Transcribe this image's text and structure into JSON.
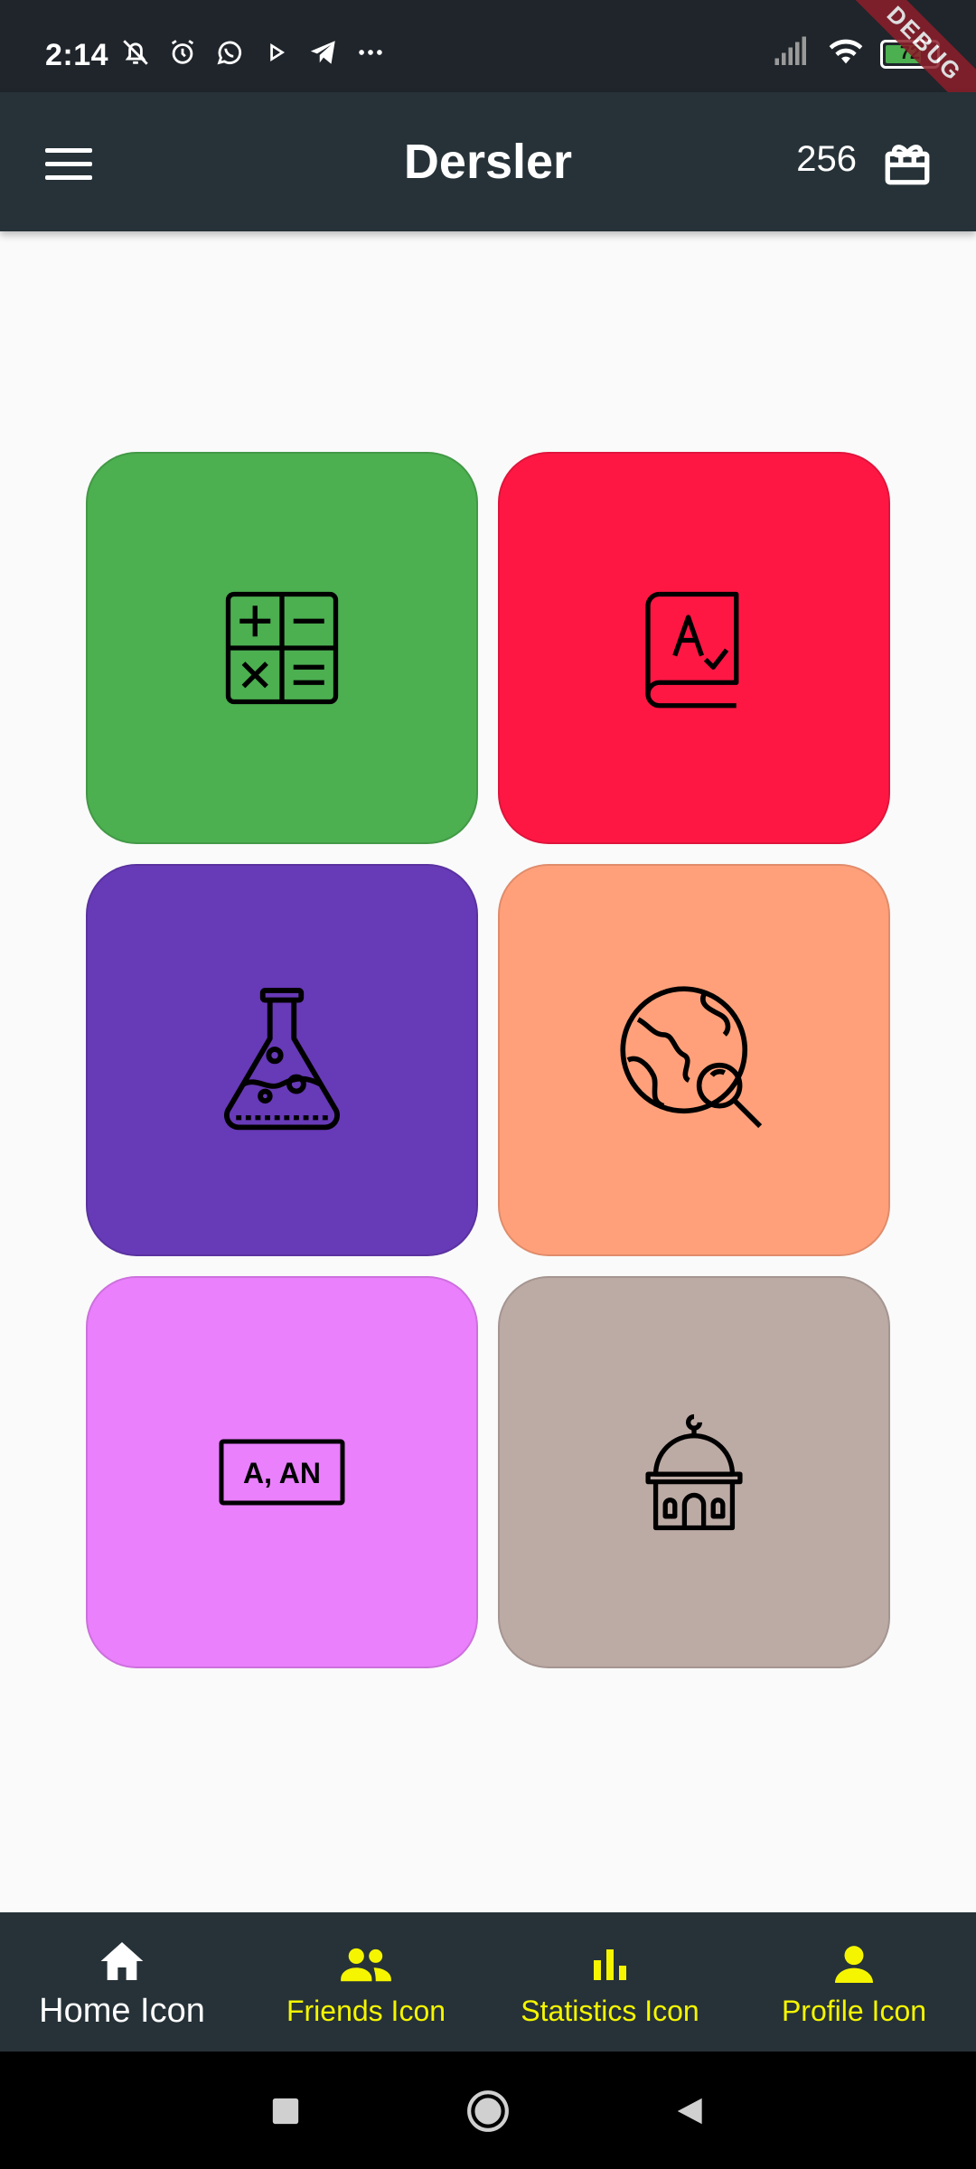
{
  "status_bar": {
    "time": "2:14",
    "battery": "72",
    "battery_level": 0.72,
    "debug_banner": "DEBUG",
    "icons": [
      "bell-off-icon",
      "alarm-icon",
      "whatsapp-icon",
      "play-icon",
      "telegram-icon",
      "more-icon",
      "signal-icon",
      "wifi-icon",
      "battery-icon"
    ]
  },
  "app_bar": {
    "title": "Dersler",
    "coins": "256",
    "menu_icon": "menu-icon",
    "gift_icon": "gift-icon"
  },
  "subjects": [
    {
      "name": "math-tile",
      "icon": "calculator-icon",
      "color": "#4caf50"
    },
    {
      "name": "turkish-tile",
      "icon": "dictionary-book-icon",
      "color": "#ff1744"
    },
    {
      "name": "science-tile",
      "icon": "flask-icon",
      "color": "#673ab7"
    },
    {
      "name": "geography-tile",
      "icon": "globe-search-icon",
      "color": "#ffa07a"
    },
    {
      "name": "english-tile",
      "icon": "article-a-an-icon",
      "icon_text": "A, AN",
      "color": "#ea80fc"
    },
    {
      "name": "religion-tile",
      "icon": "mosque-icon",
      "color": "#bcaaa4"
    }
  ],
  "bottom_nav": {
    "items": [
      {
        "label": "Home Icon",
        "icon": "home-icon",
        "active": true
      },
      {
        "label": "Friends Icon",
        "icon": "friends-icon",
        "active": false
      },
      {
        "label": "Statistics Icon",
        "icon": "statistics-icon",
        "active": false
      },
      {
        "label": "Profile Icon",
        "icon": "profile-icon",
        "active": false
      }
    ],
    "active_color": "#ffffff",
    "inactive_color": "#f5f500"
  },
  "system_nav": {
    "icons": [
      "recents-icon",
      "home-circle-icon",
      "back-icon"
    ]
  }
}
